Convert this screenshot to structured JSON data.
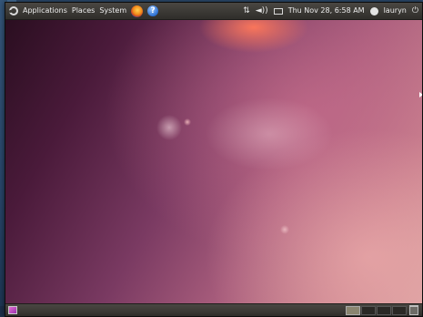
{
  "top_panel": {
    "menus": [
      "Applications",
      "Places",
      "System"
    ],
    "icons": [
      "ubuntu-logo-icon",
      "firefox-icon",
      "help-icon",
      "network-icon",
      "volume-icon",
      "mail-icon",
      "user-icon",
      "power-icon"
    ],
    "clock": "Thu Nov 28, 6:58 AM",
    "user": "lauryn",
    "help_glyph": "?",
    "network_glyph": "⇅",
    "volume_glyph": "◄))",
    "power_glyph": "⏻"
  },
  "bottom_panel": {
    "icons": [
      "show-desktop-icon",
      "trash-icon"
    ],
    "workspaces": [
      "workspace-1",
      "workspace-2",
      "workspace-3",
      "workspace-4"
    ],
    "active_workspace": 1
  },
  "colors": {
    "panel": "#3b3935",
    "panel_text": "#e8e6e1",
    "wallpaper_dark": "#2a0e20",
    "wallpaper_light": "#d9a0a0",
    "accent_orange": "#ff785a"
  }
}
